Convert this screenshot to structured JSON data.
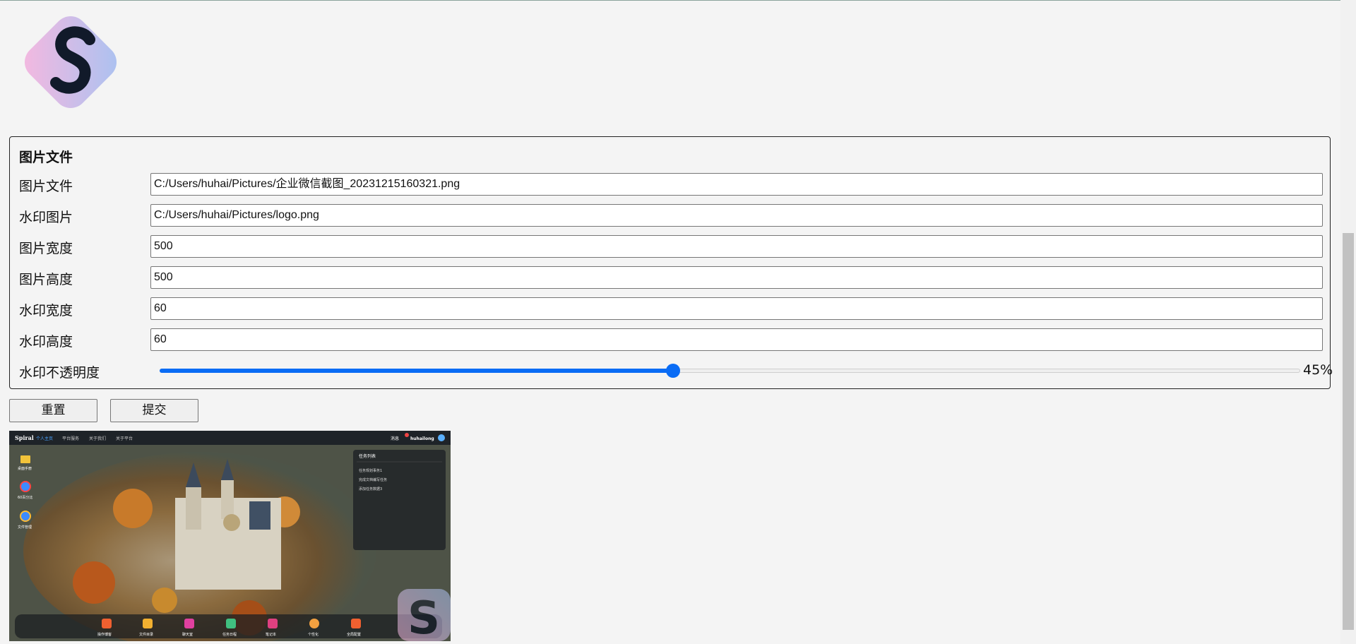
{
  "logo": {
    "glyph": "S",
    "gradient_from": "#f4b9e0",
    "gradient_to": "#aac3f0"
  },
  "form": {
    "legend": "图片文件",
    "fields": [
      {
        "label": "图片文件",
        "value": "C:/Users/huhai/Pictures/企业微信截图_20231215160321.png"
      },
      {
        "label": "水印图片",
        "value": "C:/Users/huhai/Pictures/logo.png"
      },
      {
        "label": "图片宽度",
        "value": "500"
      },
      {
        "label": "图片高度",
        "value": "500"
      },
      {
        "label": "水印宽度",
        "value": "60"
      },
      {
        "label": "水印高度",
        "value": "60"
      }
    ],
    "opacity": {
      "label": "水印不透明度",
      "value": 0.45,
      "display": "45%"
    }
  },
  "buttons": {
    "reset": "重置",
    "submit": "提交"
  },
  "preview": {
    "brand": "Spiral",
    "nav": [
      "个人主页",
      "平台服务",
      "关于我们",
      "关于平台"
    ],
    "user": "huhailong",
    "mail": "消息",
    "panel_title": "任务列表",
    "tasks": [
      "任务规划事务1",
      "完成文档编写任务",
      "添加任务数据3"
    ],
    "desktop_icons": [
      "桌面手册",
      "60百分比",
      "文件管理"
    ],
    "dock": [
      "操作博客",
      "文件目录",
      "聊天室",
      "任务日程",
      "笔记本",
      "个性化",
      "全局配置"
    ],
    "watermark_glyph": "S"
  },
  "colors": {
    "accent": "#0a6cf5",
    "panel_bg": "#f4f4f4"
  }
}
